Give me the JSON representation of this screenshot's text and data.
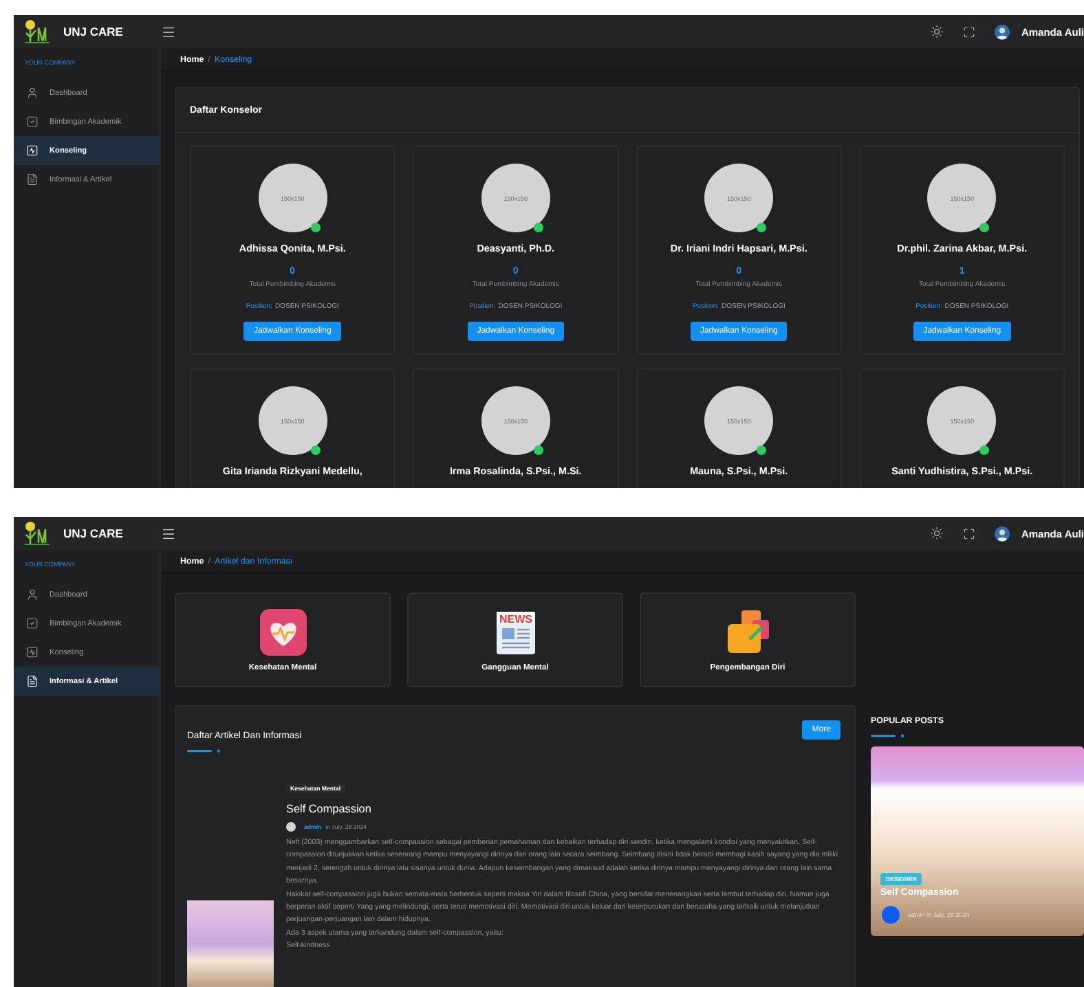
{
  "screens": [
    {
      "brand": "UNJ CARE",
      "user": "Amanda Auli",
      "sidebar": {
        "section": "YOUR COMPANY",
        "items": [
          {
            "label": "Dashboard",
            "kind": "user",
            "selected": false
          },
          {
            "label": "Bimbingan Akademik",
            "kind": "check",
            "selected": false
          },
          {
            "label": "Konseling",
            "kind": "chart",
            "selected": true
          },
          {
            "label": "Informasi & Artikel",
            "kind": "file",
            "selected": false
          }
        ]
      },
      "breadcrumb": {
        "home": "Home",
        "separator": "/",
        "current": "Konseling"
      },
      "page": {
        "kind": "counselors",
        "title": "Daftar Konselor",
        "counselors": [
          {
            "name": "Adhissa Qonita, M.Psi.",
            "photo_text": "150x150",
            "online": true,
            "count": "0",
            "count_label": "Total Pembimbing Akademis",
            "position_label": "Position:",
            "position": "DOSEN PSIKOLOGI",
            "button": "Jadwalkan Konseling"
          },
          {
            "name": "Deasyanti, Ph.D.",
            "photo_text": "150x150",
            "online": true,
            "count": "0",
            "count_label": "Total Pembimbing Akademis",
            "position_label": "Position:",
            "position": "DOSEN PSIKOLOGI",
            "button": "Jadwalkan Konseling"
          },
          {
            "name": "Dr. Iriani Indri Hapsari, M.Psi.",
            "photo_text": "150x150",
            "online": true,
            "count": "0",
            "count_label": "Total Pembimbing Akademis",
            "position_label": "Position:",
            "position": "DOSEN PSIKOLOGI",
            "button": "Jadwalkan Konseling"
          },
          {
            "name": "Dr.phil. Zarina Akbar, M.Psi.",
            "photo_text": "150x150",
            "online": true,
            "count": "1",
            "count_label": "Total Pembimbing Akademis",
            "position_label": "Position:",
            "position": "DOSEN PSIKOLOGI",
            "button": "Jadwalkan Konseling"
          },
          {
            "name": "Gita Irianda Rizkyani Medellu,",
            "photo_text": "150x150",
            "online": true
          },
          {
            "name": "Irma Rosalinda, S.Psi., M.Si.",
            "photo_text": "150x150",
            "online": true
          },
          {
            "name": "Mauna, S.Psi., M.Psi.",
            "photo_text": "150x150",
            "online": true
          },
          {
            "name": "Santi Yudhistira, S.Psi., M.Psi.",
            "photo_text": "150x150",
            "online": true
          }
        ]
      }
    },
    {
      "brand": "UNJ CARE",
      "user": "Amanda Auli",
      "sidebar": {
        "section": "YOUR COMPANY",
        "items": [
          {
            "label": "Dashboard",
            "kind": "user",
            "selected": false
          },
          {
            "label": "Bimbingan Akademik",
            "kind": "check",
            "selected": false
          },
          {
            "label": "Konseling",
            "kind": "chart",
            "selected": false
          },
          {
            "label": "Informasi & Artikel",
            "kind": "file",
            "selected": true
          }
        ]
      },
      "breadcrumb": {
        "home": "Home",
        "separator": "/",
        "current": "Artikel dan Informasi"
      },
      "page": {
        "kind": "articles",
        "categories": [
          {
            "label": "Kesehatan Mental",
            "kind": "heart"
          },
          {
            "label": "Gangguan Mental",
            "kind": "news",
            "icon_text": "NEWS"
          },
          {
            "label": "Pengembangan Diri",
            "kind": "growth"
          }
        ],
        "list": {
          "title": "Daftar Artikel Dan Informasi",
          "more": "More",
          "article": {
            "tag": "Kesehatan Mental",
            "title": "Self Compassion",
            "author": "admin",
            "date": "in July, 28 2024",
            "paragraphs": [
              "Neff (2003) menggambarkan self-compassion sebagai pemberian pemahaman dan kebaikan terhadap diri sendiri, ketika mengalami kondisi yang menyakitkan. Self-compassion ditunjukkan ketika seseorang mampu menyayangi dirinya dan orang lain secara seimbang. Seimbang disini tidak berarti membagi kasih sayang yang dia miliki menjadi 2, setengah untuk dirinya lalu sisanya untuk dunia. Adapun keseimbangan yang dimaksud adalah ketika dirinya mampu menyayangi dirinya dan orang lain sama besarnya.",
              "Hakikat self-compassion juga bukan semata-mata berbentuk seperti makna Yin dalam filosofi China, yang bersifat menenangkan serta lembut terhadap diri. Namun juga berperan aktif seperti Yang yang melindungi, serta terus memotivasi diri. Memotivasi diri untuk keluar dari keterpurukan dan berusaha yang terbaik untuk melanjutkan perjuangan-perjuangan lain dalam hidupnya.",
              "Ada 3 aspek utama yang terkandung dalam self-compassion, yaitu:",
              "Self-kindness"
            ]
          }
        },
        "popular": {
          "title": "POPULAR POSTS",
          "post": {
            "tag": "DESIGNER",
            "title": "Self Compassion",
            "meta": "admin in July, 28 2024"
          }
        }
      }
    }
  ]
}
